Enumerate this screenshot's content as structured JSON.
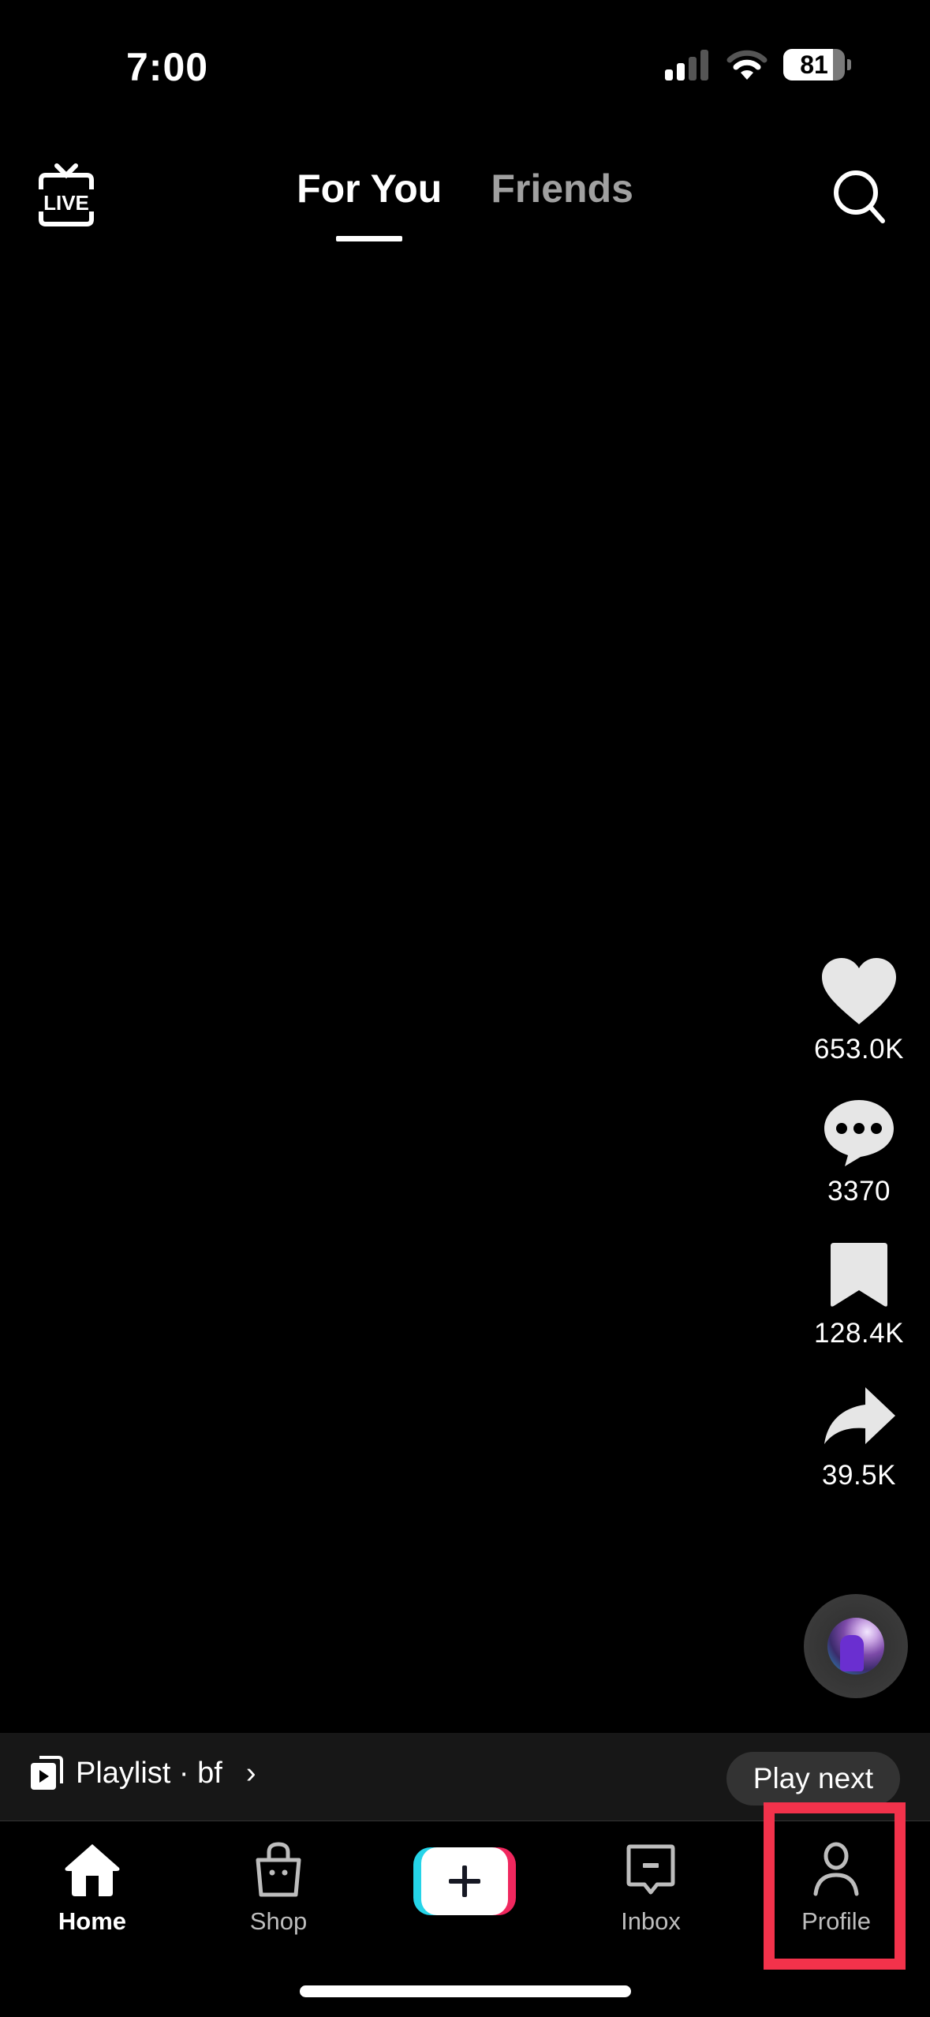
{
  "status_bar": {
    "time": "7:00",
    "signal_icon": "cellular-signal-icon",
    "signal_bars_active": 2,
    "signal_bars_total": 4,
    "wifi_icon": "wifi-icon",
    "battery_percent": "81",
    "battery_level": 0.81
  },
  "top_nav": {
    "live_icon": "live-tv-icon",
    "live_label": "LIVE",
    "tabs": [
      {
        "label": "For You",
        "active": true
      },
      {
        "label": "Friends",
        "active": false
      }
    ],
    "search_icon": "search-icon"
  },
  "actions": {
    "like": {
      "icon": "heart-icon",
      "count": "653.0K"
    },
    "comment": {
      "icon": "comment-icon",
      "count": "3370"
    },
    "bookmark": {
      "icon": "bookmark-icon",
      "count": "128.4K"
    },
    "share": {
      "icon": "share-icon",
      "count": "39.5K"
    },
    "sound_disc": {
      "icon": "music-disc-icon"
    }
  },
  "playlist_bar": {
    "icon": "playlist-icon",
    "label": "Playlist · bf",
    "chevron": "›",
    "play_next_label": "Play next"
  },
  "bottom_nav": {
    "items": [
      {
        "label": "Home",
        "icon": "home-icon",
        "active": true
      },
      {
        "label": "Shop",
        "icon": "shop-bag-icon",
        "active": false
      },
      {
        "label": "",
        "icon": "create-plus-icon",
        "active": false
      },
      {
        "label": "Inbox",
        "icon": "inbox-icon",
        "active": false
      },
      {
        "label": "Profile",
        "icon": "profile-icon",
        "active": false
      }
    ]
  },
  "colors": {
    "background": "#000000",
    "highlight": "#f2324b",
    "create_cyan": "#25d4e8",
    "create_red": "#f0275e",
    "inactive_text": "#a0a0a0"
  }
}
